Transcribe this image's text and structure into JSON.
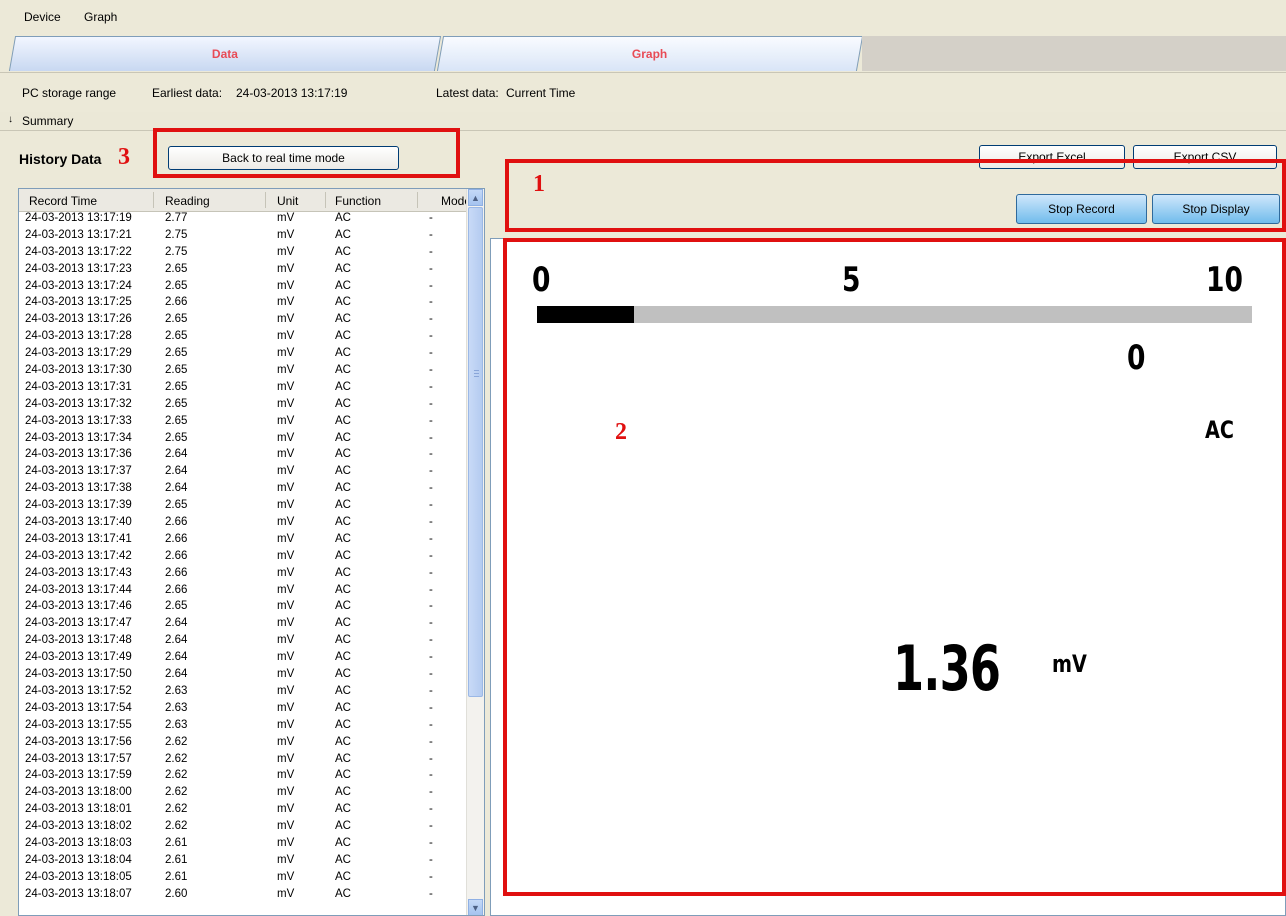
{
  "menu": {
    "device": "Device",
    "graph": "Graph"
  },
  "tabs": [
    {
      "label": "Data"
    },
    {
      "label": "Graph"
    }
  ],
  "info": {
    "range_label": "PC storage range",
    "earliest_label": "Earliest data:",
    "earliest_value": "24-03-2013 13:17:19",
    "latest_label": "Latest data:",
    "latest_value": "Current Time"
  },
  "summary": {
    "label": "Summary",
    "icon": "double-chevron-down-icon"
  },
  "history": {
    "title": "History Data",
    "back_button": "Back to real time mode"
  },
  "buttons": {
    "export_excel": "Export Excel",
    "export_csv": "Export CSV",
    "stop_record": "Stop Record",
    "stop_display": "Stop Display"
  },
  "annotations": {
    "one": "1",
    "two": "2",
    "three": "3"
  },
  "table": {
    "columns": [
      "Record Time",
      "Reading",
      "Unit",
      "Function",
      "Mode"
    ],
    "rows": [
      [
        "24-03-2013 13:17:19",
        "2.77",
        "mV",
        "AC",
        "-"
      ],
      [
        "24-03-2013 13:17:21",
        "2.75",
        "mV",
        "AC",
        "-"
      ],
      [
        "24-03-2013 13:17:22",
        "2.75",
        "mV",
        "AC",
        "-"
      ],
      [
        "24-03-2013 13:17:23",
        "2.65",
        "mV",
        "AC",
        "-"
      ],
      [
        "24-03-2013 13:17:24",
        "2.65",
        "mV",
        "AC",
        "-"
      ],
      [
        "24-03-2013 13:17:25",
        "2.66",
        "mV",
        "AC",
        "-"
      ],
      [
        "24-03-2013 13:17:26",
        "2.65",
        "mV",
        "AC",
        "-"
      ],
      [
        "24-03-2013 13:17:28",
        "2.65",
        "mV",
        "AC",
        "-"
      ],
      [
        "24-03-2013 13:17:29",
        "2.65",
        "mV",
        "AC",
        "-"
      ],
      [
        "24-03-2013 13:17:30",
        "2.65",
        "mV",
        "AC",
        "-"
      ],
      [
        "24-03-2013 13:17:31",
        "2.65",
        "mV",
        "AC",
        "-"
      ],
      [
        "24-03-2013 13:17:32",
        "2.65",
        "mV",
        "AC",
        "-"
      ],
      [
        "24-03-2013 13:17:33",
        "2.65",
        "mV",
        "AC",
        "-"
      ],
      [
        "24-03-2013 13:17:34",
        "2.65",
        "mV",
        "AC",
        "-"
      ],
      [
        "24-03-2013 13:17:36",
        "2.64",
        "mV",
        "AC",
        "-"
      ],
      [
        "24-03-2013 13:17:37",
        "2.64",
        "mV",
        "AC",
        "-"
      ],
      [
        "24-03-2013 13:17:38",
        "2.64",
        "mV",
        "AC",
        "-"
      ],
      [
        "24-03-2013 13:17:39",
        "2.65",
        "mV",
        "AC",
        "-"
      ],
      [
        "24-03-2013 13:17:40",
        "2.66",
        "mV",
        "AC",
        "-"
      ],
      [
        "24-03-2013 13:17:41",
        "2.66",
        "mV",
        "AC",
        "-"
      ],
      [
        "24-03-2013 13:17:42",
        "2.66",
        "mV",
        "AC",
        "-"
      ],
      [
        "24-03-2013 13:17:43",
        "2.66",
        "mV",
        "AC",
        "-"
      ],
      [
        "24-03-2013 13:17:44",
        "2.66",
        "mV",
        "AC",
        "-"
      ],
      [
        "24-03-2013 13:17:46",
        "2.65",
        "mV",
        "AC",
        "-"
      ],
      [
        "24-03-2013 13:17:47",
        "2.64",
        "mV",
        "AC",
        "-"
      ],
      [
        "24-03-2013 13:17:48",
        "2.64",
        "mV",
        "AC",
        "-"
      ],
      [
        "24-03-2013 13:17:49",
        "2.64",
        "mV",
        "AC",
        "-"
      ],
      [
        "24-03-2013 13:17:50",
        "2.64",
        "mV",
        "AC",
        "-"
      ],
      [
        "24-03-2013 13:17:52",
        "2.63",
        "mV",
        "AC",
        "-"
      ],
      [
        "24-03-2013 13:17:54",
        "2.63",
        "mV",
        "AC",
        "-"
      ],
      [
        "24-03-2013 13:17:55",
        "2.63",
        "mV",
        "AC",
        "-"
      ],
      [
        "24-03-2013 13:17:56",
        "2.62",
        "mV",
        "AC",
        "-"
      ],
      [
        "24-03-2013 13:17:57",
        "2.62",
        "mV",
        "AC",
        "-"
      ],
      [
        "24-03-2013 13:17:59",
        "2.62",
        "mV",
        "AC",
        "-"
      ],
      [
        "24-03-2013 13:18:00",
        "2.62",
        "mV",
        "AC",
        "-"
      ],
      [
        "24-03-2013 13:18:01",
        "2.62",
        "mV",
        "AC",
        "-"
      ],
      [
        "24-03-2013 13:18:02",
        "2.62",
        "mV",
        "AC",
        "-"
      ],
      [
        "24-03-2013 13:18:03",
        "2.61",
        "mV",
        "AC",
        "-"
      ],
      [
        "24-03-2013 13:18:04",
        "2.61",
        "mV",
        "AC",
        "-"
      ],
      [
        "24-03-2013 13:18:05",
        "2.61",
        "mV",
        "AC",
        "-"
      ],
      [
        "24-03-2013 13:18:07",
        "2.60",
        "mV",
        "AC",
        "-"
      ]
    ]
  },
  "meter": {
    "scale": {
      "min": "0",
      "mid": "5",
      "max": "10"
    },
    "bar_fraction": 0.136,
    "secondary_value": "0",
    "function": "AC",
    "reading": "1.36",
    "unit": "mV"
  },
  "colors": {
    "annotation": "#e01010",
    "tab_text": "#e84b56",
    "bar_fill": "#000000",
    "bar_track": "#c0c0c0"
  }
}
